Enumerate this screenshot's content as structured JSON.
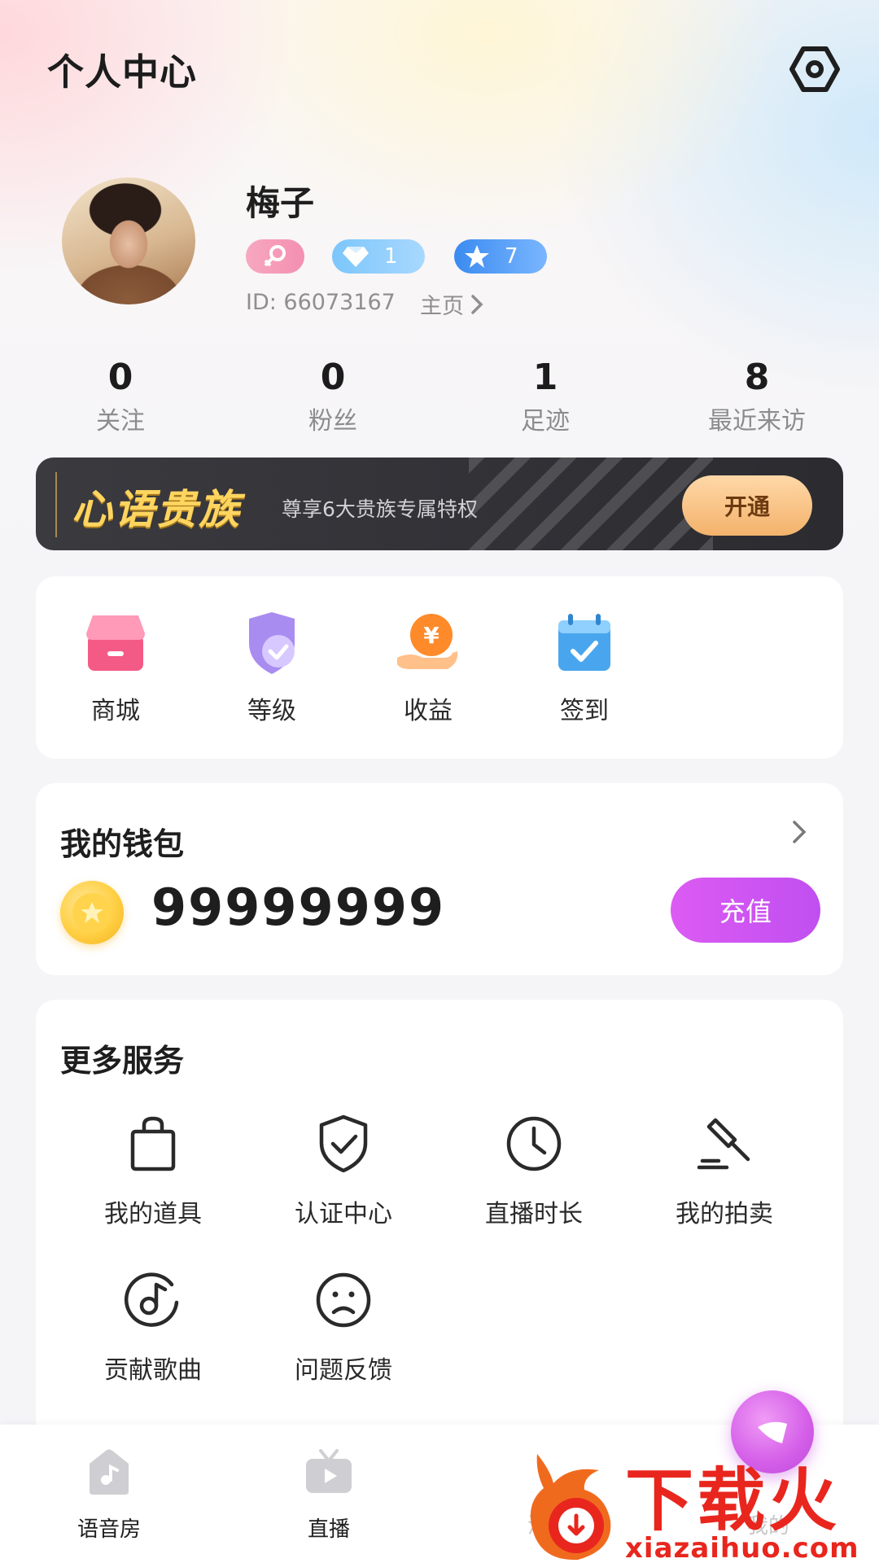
{
  "header": {
    "title": "个人中心"
  },
  "profile": {
    "name": "梅子",
    "badges": {
      "gender_icon": "female-icon",
      "diamond_level": "1",
      "star_level": "7"
    },
    "id_text": "ID: 66073167",
    "homepage_label": "主页"
  },
  "stats": [
    {
      "value": "0",
      "label": "关注"
    },
    {
      "value": "0",
      "label": "粉丝"
    },
    {
      "value": "1",
      "label": "足迹"
    },
    {
      "value": "8",
      "label": "最近来访"
    }
  ],
  "vip_banner": {
    "title": "心语贵族",
    "subtitle": "尊享6大贵族专属特权",
    "button_label": "开通"
  },
  "quick_entries": [
    {
      "label": "商城",
      "icon": "shop-icon"
    },
    {
      "label": "等级",
      "icon": "level-shield-icon"
    },
    {
      "label": "收益",
      "icon": "income-coin-icon"
    },
    {
      "label": "签到",
      "icon": "checkin-calendar-icon"
    }
  ],
  "wallet": {
    "title": "我的钱包",
    "balance": "99999999",
    "recharge_label": "充值"
  },
  "services": {
    "title": "更多服务",
    "items": [
      {
        "label": "我的道具",
        "icon": "bag-icon"
      },
      {
        "label": "认证中心",
        "icon": "shield-check-icon"
      },
      {
        "label": "直播时长",
        "icon": "clock-icon"
      },
      {
        "label": "我的拍卖",
        "icon": "gavel-icon"
      },
      {
        "label": "贡献歌曲",
        "icon": "music-disc-icon"
      },
      {
        "label": "问题反馈",
        "icon": "sad-face-icon"
      }
    ]
  },
  "bottom_nav": [
    {
      "label": "语音房",
      "icon": "voice-room-icon"
    },
    {
      "label": "直播",
      "icon": "tv-live-icon"
    },
    {
      "label": "消息",
      "icon": "message-icon"
    },
    {
      "label": "我的",
      "icon": "profile-icon"
    }
  ],
  "watermark": {
    "text": "下载火",
    "url": "xiazaihuo.com"
  },
  "colors": {
    "accent_purple": "#c04ff0",
    "vip_gold": "#ffd560",
    "watermark_red": "#e8261e"
  }
}
